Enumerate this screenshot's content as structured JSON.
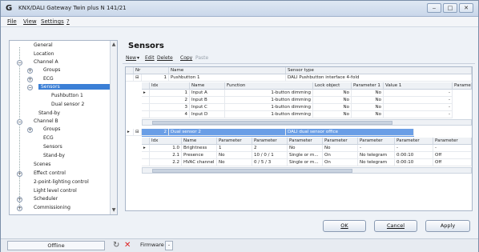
{
  "window": {
    "title": "KNX/DALI Gateway Twin plus N 141/21",
    "controls": {
      "minimize": "‒",
      "maximize": "□",
      "close": "✕"
    }
  },
  "menu": {
    "items": [
      "File",
      "View",
      "Settings",
      "?"
    ]
  },
  "tree": {
    "items": [
      {
        "label": "General",
        "level": 0
      },
      {
        "label": "Location",
        "level": 0
      },
      {
        "label": "Channel A",
        "level": 0
      },
      {
        "label": "Groups",
        "level": 1
      },
      {
        "label": "ECG",
        "level": 1
      },
      {
        "label": "Sensors",
        "level": 1,
        "selected": true
      },
      {
        "label": "Pushbutton 1",
        "level": 2
      },
      {
        "label": "Dual sensor 2",
        "level": 2
      },
      {
        "label": "Stand-by",
        "level": 1
      },
      {
        "label": "Channel B",
        "level": 0
      },
      {
        "label": "Groups",
        "level": 1
      },
      {
        "label": "ECG",
        "level": 1
      },
      {
        "label": "Sensors",
        "level": 1
      },
      {
        "label": "Stand-by",
        "level": 1
      },
      {
        "label": "Scenes",
        "level": 0
      },
      {
        "label": "Effect control",
        "level": 0
      },
      {
        "label": "2-point-lighting control",
        "level": 0
      },
      {
        "label": "Light level control",
        "level": 0
      },
      {
        "label": "Scheduler",
        "level": 0
      },
      {
        "label": "Commissioning",
        "level": 0
      }
    ]
  },
  "panel": {
    "title": "Sensors",
    "toolbar": {
      "new": "New",
      "edit": "Edit",
      "delete": "Delete",
      "copy": "Copy",
      "paste": "Paste"
    }
  },
  "grid": {
    "headers": {
      "nr": "Nr",
      "name": "Name",
      "sensor_type": "Sensor type"
    },
    "sensors": [
      {
        "nr": "1",
        "name": "Pushbutton 1",
        "type": "DALI Pushbutton interface 4-fold"
      },
      {
        "nr": "2",
        "name": "Dual sensor 2",
        "type": "DALI dual sensor office"
      }
    ],
    "sub1": {
      "headers": [
        "Idx",
        "Name",
        "Function",
        "Lock object",
        "Parameter 1",
        "Value 1",
        "Paramet"
      ],
      "rows": [
        [
          "1",
          "Input A",
          "1-button dimming",
          "No",
          "No",
          "-"
        ],
        [
          "2",
          "Input B",
          "1-button dimming",
          "No",
          "No",
          "-"
        ],
        [
          "3",
          "Input C",
          "1-button dimming",
          "No",
          "No",
          "-"
        ],
        [
          "4",
          "Input D",
          "1-button dimming",
          "No",
          "No",
          "-"
        ]
      ]
    },
    "sub2": {
      "headers": [
        "Idx",
        "Name",
        "Parameter",
        "Parameter",
        "Parameter",
        "Parameter",
        "Parameter",
        "Parameter",
        "Parameter"
      ],
      "rows": [
        [
          "1.0",
          "Brightness",
          "1",
          "2",
          "No",
          "No",
          "-",
          "-",
          "-"
        ],
        [
          "2.1",
          "Presence",
          "No",
          "10 / 0 / 1",
          "Single or m...",
          "On",
          "No telegram",
          "0:00:10",
          "Off"
        ],
        [
          "2.2",
          "HVAC channel",
          "No",
          "0 / 5 / 3",
          "Single or m...",
          "On",
          "No telegram",
          "0:00:10",
          "Off"
        ]
      ]
    }
  },
  "buttons": {
    "ok": "OK",
    "cancel": "Cancel",
    "apply": "Apply"
  },
  "status": {
    "connection": "Offline",
    "firmware": "Firmware",
    "firmware_value": "-"
  }
}
